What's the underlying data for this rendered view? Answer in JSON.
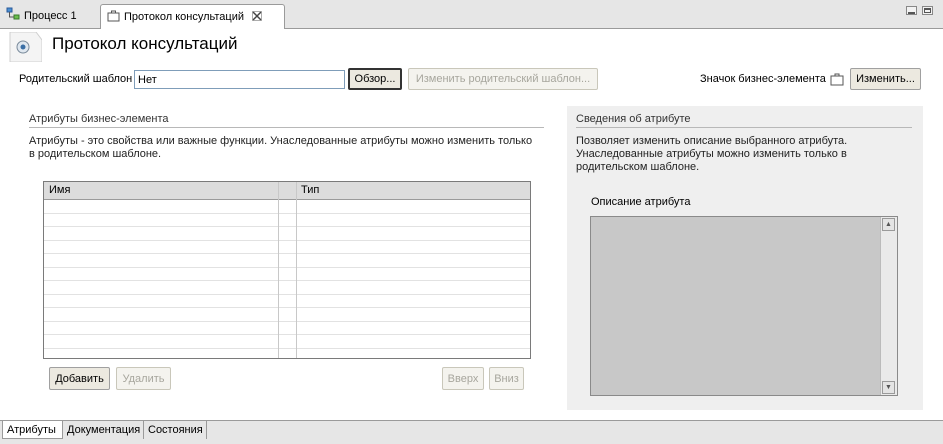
{
  "tabs": [
    {
      "label": "Процесс 1",
      "icon": "process-icon"
    },
    {
      "label": "Протокол консультаций",
      "icon": "briefcase-icon",
      "close_icon": "close-icon",
      "active": true
    }
  ],
  "header": {
    "title": "Протокол консультаций",
    "icon": "business-item-icon"
  },
  "parent_template": {
    "label": "Родительский шаблон",
    "value": "Нет",
    "browse_label": "Обзор...",
    "change_parent_label": "Изменить родительский шаблон..."
  },
  "business_icon": {
    "label": "Значок бизнес-элемента",
    "icon": "briefcase-icon",
    "change_label": "Изменить..."
  },
  "attributes": {
    "section_title": "Атрибуты бизнес-элемента",
    "description_line1": "Атрибуты - это свойства или важные функции. Унаследованные атрибуты можно изменить только",
    "description_line2": "в родительском шаблоне.",
    "columns": [
      "Имя",
      "",
      "Тип"
    ],
    "rows": [],
    "add_label": "Добавить",
    "delete_label": "Удалить",
    "up_label": "Вверх",
    "down_label": "Вниз"
  },
  "attribute_info": {
    "section_title": "Сведения об атрибуте",
    "description_line1": "Позволяет изменить описание выбранного атрибута.",
    "description_line2": "Унаследованные атрибуты можно изменить только в",
    "description_line3": "родительском шаблоне.",
    "field_label": "Описание атрибута",
    "field_value": ""
  },
  "bottom_tabs": [
    {
      "label": "Атрибуты",
      "active": true
    },
    {
      "label": "Документация",
      "active": false
    },
    {
      "label": "Состояния",
      "active": false
    }
  ],
  "colors": {
    "tabbar": "#e6e6e6",
    "panel": "#efefef",
    "textarea": "#c8c8c8",
    "button": "#ece9e0"
  }
}
